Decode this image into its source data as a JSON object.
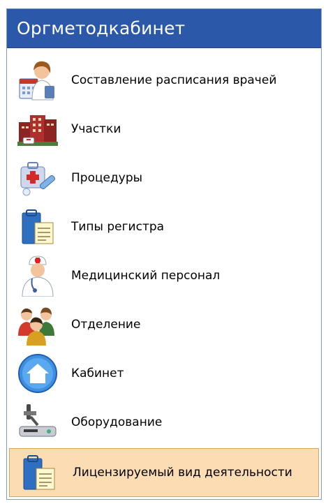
{
  "panel": {
    "title": "Оргметодкабинет"
  },
  "items": [
    {
      "label": "Составление расписания врачей",
      "icon": "doctor-schedule-icon"
    },
    {
      "label": "Участки",
      "icon": "hospital-building-icon"
    },
    {
      "label": "Процедуры",
      "icon": "medical-kit-icon"
    },
    {
      "label": "Типы регистра",
      "icon": "folder-document-icon"
    },
    {
      "label": "Медицинский персонал",
      "icon": "doctor-icon"
    },
    {
      "label": "Отделение",
      "icon": "people-group-icon"
    },
    {
      "label": "Кабинет",
      "icon": "home-circle-icon"
    },
    {
      "label": "Оборудование",
      "icon": "microscope-icon"
    },
    {
      "label": "Лицензируемый вид деятельности",
      "icon": "folder-document-icon",
      "selected": true
    }
  ],
  "colors": {
    "header_bg": "#2b58a8",
    "selected_bg": "#fcdcb2",
    "border": "#7f9db9"
  }
}
